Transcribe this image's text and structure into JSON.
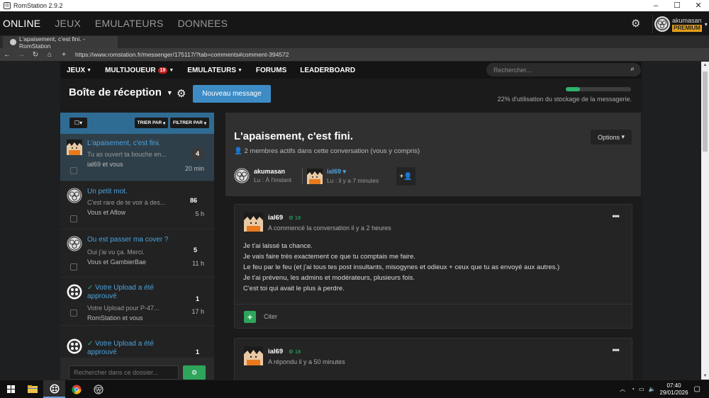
{
  "window": {
    "title": "RomStation 2.9.2",
    "min": "–",
    "max": "☐",
    "close": "✕"
  },
  "topnav": {
    "items": [
      "ONLINE",
      "JEUX",
      "EMULATEURS",
      "DONNEES"
    ],
    "user": "akumasan",
    "premium": "PREMIUM"
  },
  "tab": {
    "label": "L'apaisement, c'est fini. - RomStation"
  },
  "url": "https://www.romstation.fr/messenger/175117/?tab=comments#comment-394572",
  "sitenav": {
    "items": [
      "JEUX",
      "MULTIJOUEUR",
      "EMULATEURS",
      "FORUMS",
      "LEADERBOARD"
    ],
    "multi_badge": "19",
    "search_placeholder": "Rechercher..."
  },
  "header": {
    "title": "Boîte de réception",
    "new_message": "Nouveau message",
    "storage_fraction": 0.22,
    "storage_text": "22% d'utilisation du stockage de la messagerie."
  },
  "list": {
    "sort": "TRIER PAR",
    "filter": "FILTRER PAR",
    "conversations": [
      {
        "title": "L'apaisement, c'est fini.",
        "preview": "Tu as ouvert ta bouche en...",
        "who": "ial69 et vous",
        "count": "4",
        "time": "20 min"
      },
      {
        "title": "Un petit mot.",
        "preview": "C'est rare de te voir à des...",
        "who": "Vous et Aflow",
        "count": "86",
        "time": "5 h"
      },
      {
        "title": "Ou est passer ma cover ?",
        "preview": "Oui j'ai vu ça. Merci.",
        "who": "Vous et GambierBae",
        "count": "5",
        "time": "11 h"
      },
      {
        "title": "Votre Upload a été approuvé",
        "preview": "Votre Upload pour P-47...",
        "who": "RomStation et vous",
        "count": "1",
        "time": "17 h"
      },
      {
        "title": "Votre Upload a été approuvé",
        "preview": "",
        "who": "",
        "count": "1",
        "time": ""
      }
    ],
    "folder_search_placeholder": "Rechercher dans ce dossier..."
  },
  "conversation": {
    "title": "L'apaisement, c'est fini.",
    "subtitle": "2 membres actifs dans cette conversation (vous y compris)",
    "options": "Options",
    "members": [
      {
        "name": "akumasan",
        "status": "Lu : À l'instant"
      },
      {
        "name": "ial69",
        "status": "Lu : il y a 7 minutes"
      }
    ],
    "messages": [
      {
        "author": "ial69",
        "level": "18",
        "action": "A commencé la conversation il y a 2 heures",
        "lines": [
          "Je t'ai laissé ta chance.",
          "Je vais faire très exactement ce que tu comptais me faire.",
          "Le feu par le feu (et j'ai tous tes post insultants, misogynes et odieux + ceux que tu as envoyé aux autres.)",
          "Je t'ai prévenu, les admins et modérateurs, plusieurs fois.",
          "C'est toi qui avait le plus à perdre."
        ],
        "quote": "Citer"
      },
      {
        "author": "ial69",
        "level": "18",
        "action": "A répondu il y a 50 minutes"
      }
    ]
  },
  "taskbar": {
    "time": "07:40",
    "date": "29/01/2026"
  }
}
